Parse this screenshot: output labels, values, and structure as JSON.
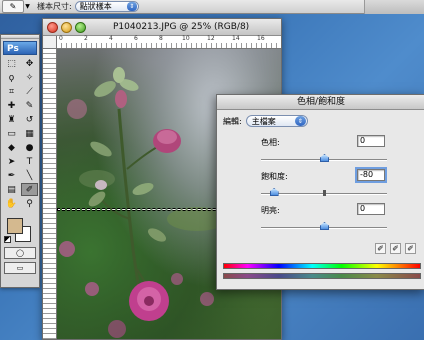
{
  "options_bar": {
    "tool_icon": "eyedropper-icon",
    "sample_size_label": "樣本尺寸:",
    "sample_size_value": "點狀樣本"
  },
  "document": {
    "title": "P1040213.JPG @ 25% (RGB/8)",
    "ruler_marks": [
      "0",
      "2",
      "4",
      "6",
      "8",
      "10",
      "12",
      "14",
      "16"
    ]
  },
  "tools": {
    "logo": "Ps"
  },
  "dialog": {
    "title": "色相/飽和度",
    "edit_label": "編輯:",
    "edit_value": "主檔案",
    "hue_label": "色相:",
    "hue_value": "0",
    "saturation_label": "飽和度:",
    "saturation_value": "-80",
    "lightness_label": "明亮:",
    "lightness_value": "0"
  },
  "colors": {
    "foreground_swatch": "#d4b98f",
    "background_swatch": "#ffffff",
    "desktop": "#3b76b8"
  }
}
